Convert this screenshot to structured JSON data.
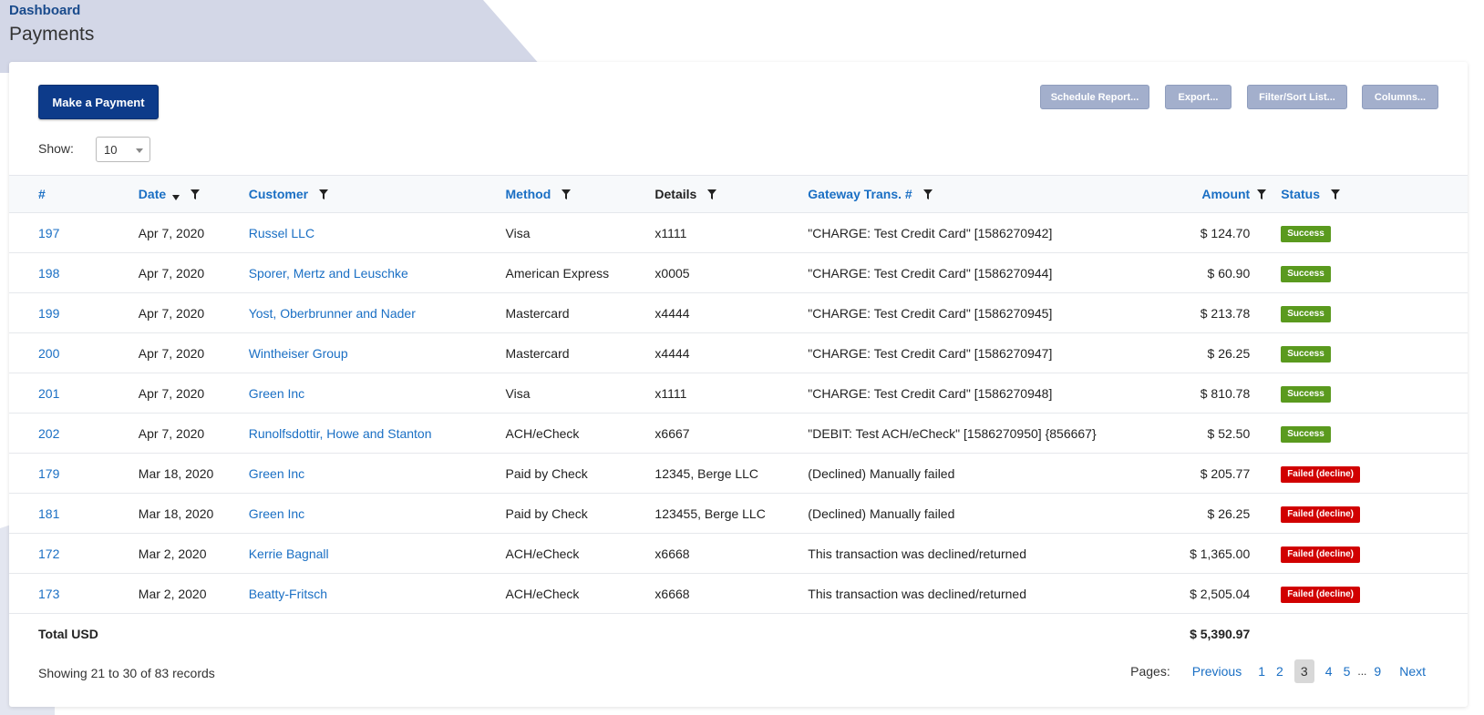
{
  "breadcrumb": "Dashboard",
  "title": "Payments",
  "toolbar": {
    "make_payment": "Make a Payment",
    "schedule_report": "Schedule Report...",
    "export": "Export...",
    "filter_sort": "Filter/Sort List...",
    "columns": "Columns..."
  },
  "show": {
    "label": "Show:",
    "value": "10"
  },
  "columns": {
    "num": "#",
    "date": "Date",
    "customer": "Customer",
    "method": "Method",
    "details": "Details",
    "gateway": "Gateway Trans. #",
    "amount": "Amount",
    "status": "Status"
  },
  "rows": [
    {
      "num": "197",
      "date": "Apr 7, 2020",
      "customer": "Russel LLC",
      "method": "Visa",
      "details": "x1111",
      "gateway": "\"CHARGE: Test Credit Card\" [1586270942]",
      "amount": "$ 124.70",
      "status": "Success",
      "failed": false
    },
    {
      "num": "198",
      "date": "Apr 7, 2020",
      "customer": "Sporer, Mertz and Leuschke",
      "method": "American Express",
      "details": "x0005",
      "gateway": "\"CHARGE: Test Credit Card\" [1586270944]",
      "amount": "$ 60.90",
      "status": "Success",
      "failed": false
    },
    {
      "num": "199",
      "date": "Apr 7, 2020",
      "customer": "Yost, Oberbrunner and Nader",
      "method": "Mastercard",
      "details": "x4444",
      "gateway": "\"CHARGE: Test Credit Card\" [1586270945]",
      "amount": "$ 213.78",
      "status": "Success",
      "failed": false
    },
    {
      "num": "200",
      "date": "Apr 7, 2020",
      "customer": "Wintheiser Group",
      "method": "Mastercard",
      "details": "x4444",
      "gateway": "\"CHARGE: Test Credit Card\" [1586270947]",
      "amount": "$ 26.25",
      "status": "Success",
      "failed": false
    },
    {
      "num": "201",
      "date": "Apr 7, 2020",
      "customer": "Green Inc",
      "method": "Visa",
      "details": "x1111",
      "gateway": "\"CHARGE: Test Credit Card\" [1586270948]",
      "amount": "$ 810.78",
      "status": "Success",
      "failed": false
    },
    {
      "num": "202",
      "date": "Apr 7, 2020",
      "customer": "Runolfsdottir, Howe and Stanton",
      "method": "ACH/eCheck",
      "details": "x6667",
      "gateway": "\"DEBIT: Test ACH/eCheck\" [1586270950] {856667}",
      "amount": "$ 52.50",
      "status": "Success",
      "failed": false
    },
    {
      "num": "179",
      "date": "Mar 18, 2020",
      "customer": "Green Inc",
      "method": "Paid by Check",
      "details": "12345, Berge LLC",
      "gateway": "(Declined) Manually failed",
      "amount": "$ 205.77",
      "status": "Failed (decline)",
      "failed": true
    },
    {
      "num": "181",
      "date": "Mar 18, 2020",
      "customer": "Green Inc",
      "method": "Paid by Check",
      "details": "123455, Berge LLC",
      "gateway": "(Declined) Manually failed",
      "amount": "$ 26.25",
      "status": "Failed (decline)",
      "failed": true
    },
    {
      "num": "172",
      "date": "Mar 2, 2020",
      "customer": "Kerrie Bagnall",
      "method": "ACH/eCheck",
      "details": "x6668",
      "gateway": "This transaction was declined/returned",
      "amount": "$ 1,365.00",
      "status": "Failed (decline)",
      "failed": true
    },
    {
      "num": "173",
      "date": "Mar 2, 2020",
      "customer": "Beatty-Fritsch",
      "method": "ACH/eCheck",
      "details": "x6668",
      "gateway": "This transaction was declined/returned",
      "amount": "$ 2,505.04",
      "status": "Failed (decline)",
      "failed": true
    }
  ],
  "total": {
    "label": "Total USD",
    "amount": "$ 5,390.97"
  },
  "footer": {
    "showing": "Showing 21 to 30 of 83 records",
    "pages_label": "Pages:",
    "previous": "Previous",
    "pages": [
      "1",
      "2",
      "3",
      "4",
      "5"
    ],
    "current_page": "3",
    "ellipsis": "...",
    "last_page": "9",
    "next": "Next"
  },
  "icons": {
    "filter": "filter-funnel-icon",
    "sort": "sort-desc-icon",
    "dropdown": "chevron-down-icon"
  },
  "colors": {
    "primary": "#0d3b8a",
    "link": "#1a6fc4",
    "success": "#5a9a1e",
    "danger": "#d10000",
    "toolbar": "#a3afcc"
  }
}
